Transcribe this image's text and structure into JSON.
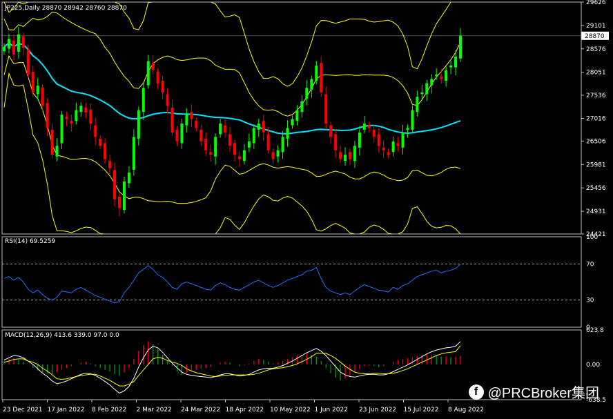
{
  "chart_data": [
    {
      "type": "candlestick",
      "title": "JP225,Daily  28870 28942 28760 28870",
      "ylim": [
        24421,
        29626
      ],
      "y_ticks": [
        29626,
        29101,
        28576,
        28051,
        27536,
        27016,
        26506,
        25981,
        25456,
        24931,
        24421
      ],
      "last_price": "28870",
      "close": [
        28620,
        28800,
        28450,
        28900,
        28600,
        28000,
        27600,
        27750,
        27300,
        26800,
        26200,
        26400,
        27100,
        27000,
        26900,
        27200,
        27300,
        27150,
        26900,
        26600,
        26400,
        26100,
        25900,
        25200,
        25000,
        25600,
        25800,
        26600,
        27200,
        27700,
        28300,
        28100,
        27800,
        27600,
        27300,
        26700,
        26500,
        26900,
        27100,
        27000,
        26800,
        26500,
        26300,
        26200,
        26600,
        26900,
        26700,
        26400,
        26200,
        26100,
        26300,
        26500,
        26800,
        26900,
        26700,
        26300,
        26100,
        26300,
        26600,
        26800,
        27000,
        27200,
        27400,
        27700,
        27900,
        28200,
        27600,
        26900,
        26600,
        26300,
        26100,
        26200,
        26100,
        26400,
        26700,
        26900,
        26800,
        26600,
        26400,
        26300,
        26200,
        26500,
        26400,
        26700,
        26800,
        27200,
        27500,
        27600,
        27800,
        27900,
        28000,
        27900,
        28100,
        28200,
        28400,
        28870
      ]
    },
    {
      "type": "line",
      "title": "RSI(14) 69.5259",
      "ylim": [
        0,
        100
      ],
      "y_ticks": [
        "100",
        "70",
        "30",
        "0"
      ],
      "levels": [
        70,
        30
      ],
      "series": [
        {
          "values": [
            54,
            56,
            52,
            55,
            50,
            42,
            38,
            41,
            36,
            32,
            30,
            33,
            40,
            39,
            38,
            42,
            44,
            41,
            38,
            35,
            33,
            31,
            29,
            27,
            28,
            38,
            44,
            52,
            60,
            64,
            68,
            64,
            58,
            55,
            50,
            44,
            42,
            48,
            50,
            48,
            46,
            44,
            42,
            41,
            46,
            49,
            47,
            44,
            42,
            41,
            44,
            47,
            50,
            52,
            49,
            46,
            44,
            46,
            49,
            52,
            54,
            56,
            58,
            62,
            63,
            66,
            54,
            44,
            40,
            38,
            36,
            38,
            36,
            40,
            44,
            47,
            45,
            43,
            41,
            40,
            39,
            44,
            42,
            46,
            48,
            52,
            56,
            58,
            60,
            62,
            63,
            60,
            62,
            63,
            65,
            69.5
          ]
        }
      ]
    },
    {
      "type": "bar",
      "title": "MACD(12,26,9) 413.6 339.0 97.0 0.0",
      "ylim": [
        -638.5,
        623.8
      ],
      "y_ticks": [
        "623.8",
        "0.00",
        "-638.5"
      ],
      "series": [
        {
          "name": "histogram",
          "values": [
            40,
            60,
            70,
            50,
            30,
            0,
            -40,
            -70,
            -90,
            -100,
            -110,
            -90,
            -60,
            -40,
            -20,
            0,
            20,
            30,
            10,
            -20,
            -40,
            -60,
            -80,
            -110,
            -130,
            -90,
            -40,
            60,
            150,
            220,
            260,
            230,
            170,
            110,
            50,
            -20,
            -80,
            -120,
            -100,
            -80,
            -60,
            -50,
            -40,
            -30,
            0,
            20,
            30,
            20,
            0,
            -20,
            -10,
            10,
            40,
            60,
            50,
            30,
            10,
            20,
            40,
            60,
            80,
            100,
            110,
            120,
            110,
            90,
            40,
            -40,
            -100,
            -150,
            -180,
            -160,
            -130,
            -90,
            -50,
            -20,
            -10,
            -20,
            -30,
            -20,
            0,
            30,
            50,
            60,
            70,
            80,
            90,
            100,
            110,
            110,
            100,
            90,
            90,
            80,
            85,
            97
          ]
        },
        {
          "name": "macd",
          "values": [
            80,
            120,
            160,
            150,
            120,
            60,
            0,
            -80,
            -160,
            -220,
            -300,
            -350,
            -330,
            -300,
            -260,
            -220,
            -180,
            -160,
            -170,
            -200,
            -250,
            -310,
            -370,
            -450,
            -520,
            -480,
            -400,
            -250,
            -50,
            120,
            260,
            330,
            300,
            220,
            120,
            20,
            -60,
            -140,
            -180,
            -200,
            -210,
            -220,
            -230,
            -240,
            -220,
            -190,
            -170,
            -170,
            -190,
            -210,
            -200,
            -180,
            -140,
            -100,
            -80,
            -70,
            -70,
            -50,
            -20,
            20,
            60,
            110,
            160,
            210,
            250,
            290,
            240,
            160,
            60,
            -40,
            -140,
            -190,
            -220,
            -230,
            -210,
            -190,
            -180,
            -180,
            -190,
            -190,
            -170,
            -130,
            -90,
            -50,
            -10,
            40,
            90,
            140,
            190,
            230,
            260,
            280,
            300,
            310,
            330,
            413.6
          ]
        },
        {
          "name": "signal",
          "values": [
            40,
            60,
            90,
            100,
            100,
            60,
            40,
            0,
            -70,
            -120,
            -190,
            -260,
            -270,
            -260,
            -240,
            -220,
            -200,
            -190,
            -180,
            -180,
            -210,
            -250,
            -290,
            -340,
            -390,
            -390,
            -360,
            -310,
            -200,
            -100,
            0,
            100,
            130,
            110,
            70,
            40,
            20,
            -20,
            -80,
            -120,
            -150,
            -170,
            -190,
            -210,
            -220,
            -210,
            -200,
            -190,
            -190,
            -190,
            -190,
            -190,
            -180,
            -160,
            -130,
            -100,
            -80,
            -70,
            -60,
            -40,
            -20,
            10,
            50,
            90,
            140,
            200,
            200,
            200,
            160,
            110,
            40,
            -30,
            -90,
            -140,
            -160,
            -170,
            -170,
            -160,
            -160,
            -170,
            -170,
            -160,
            -140,
            -110,
            -80,
            -40,
            0,
            40,
            80,
            120,
            160,
            190,
            210,
            220,
            233,
            339
          ]
        }
      ]
    }
  ],
  "x_labels": [
    "23 Dec 2021",
    "17 Jan 2022",
    "8 Feb 2022",
    "2 Mar 2022",
    "24 Mar 2022",
    "18 Apr 2022",
    "10 May 2022",
    "1 Jun 2022",
    "23 Jun 2022",
    "15 Jul 2022",
    "8 Aug 2022"
  ],
  "watermark": "@PRCBroker集团",
  "watermark_icon": "facebook-icon",
  "colors": {
    "bull": "#00ff00",
    "bear": "#ff0000",
    "ma": "#00e5ff",
    "bands": "#ffff00",
    "rsi": "#1e6fff",
    "grid": "#ffffff"
  }
}
